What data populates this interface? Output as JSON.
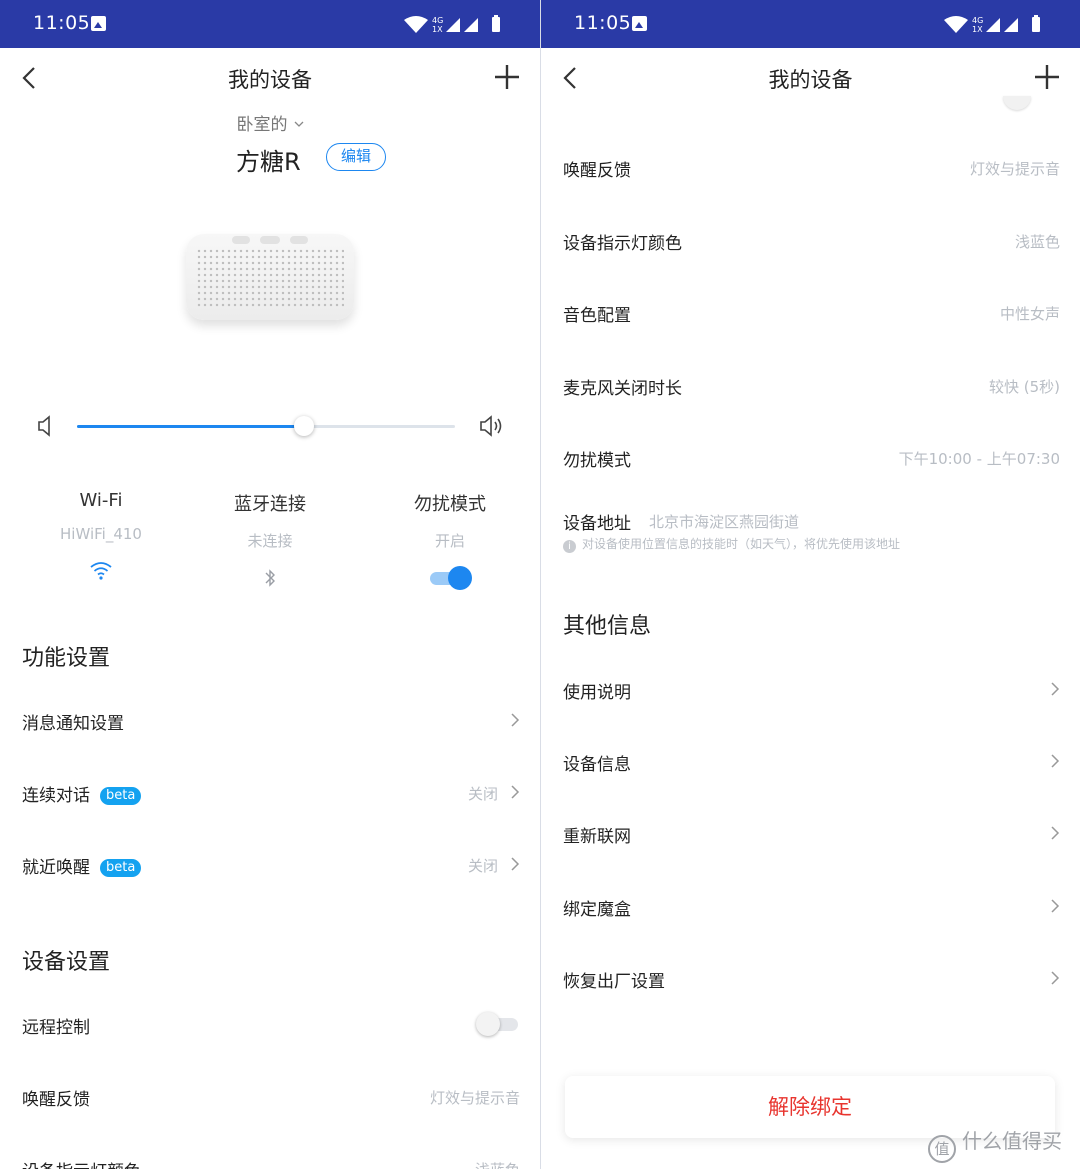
{
  "status": {
    "time": "11:05",
    "network": "4G 1X"
  },
  "header": {
    "title": "我的设备"
  },
  "left": {
    "room": "卧室的",
    "device_name": "方糖R",
    "edit_label": "编辑",
    "volume": 0.6,
    "stats": [
      {
        "title": "Wi-Fi",
        "sub": "HiWiFi_410"
      },
      {
        "title": "蓝牙连接",
        "sub": "未连接"
      },
      {
        "title": "勿扰模式",
        "sub": "开启",
        "toggle_on": true
      }
    ],
    "func_section": "功能设置",
    "func_items": [
      {
        "label": "消息通知设置",
        "value": ""
      },
      {
        "label": "连续对话",
        "badge": "beta",
        "value": "关闭"
      },
      {
        "label": "就近唤醒",
        "badge": "beta",
        "value": "关闭"
      }
    ],
    "device_section": "设备设置",
    "device_items": [
      {
        "label": "远程控制",
        "toggle_on": false
      },
      {
        "label": "唤醒反馈",
        "value": "灯效与提示音"
      },
      {
        "label": "设备指示灯颜色",
        "value": "浅蓝色"
      }
    ]
  },
  "right": {
    "rows": [
      {
        "label": "唤醒反馈",
        "value": "灯效与提示音"
      },
      {
        "label": "设备指示灯颜色",
        "value": "浅蓝色"
      },
      {
        "label": "音色配置",
        "value": "中性女声"
      },
      {
        "label": "麦克风关闭时长",
        "value": "较快 (5秒)"
      },
      {
        "label": "勿扰模式",
        "value": "下午10:00 - 上午07:30"
      }
    ],
    "address": {
      "label": "设备地址",
      "value": "北京市海淀区燕园街道",
      "note": "对设备使用位置信息的技能时（如天气），将优先使用该地址",
      "info_icon_glyph": "i"
    },
    "other_section": "其他信息",
    "other_items": [
      {
        "label": "使用说明"
      },
      {
        "label": "设备信息"
      },
      {
        "label": "重新联网"
      },
      {
        "label": "绑定魔盒"
      },
      {
        "label": "恢复出厂设置"
      }
    ],
    "unbind_label": "解除绑定",
    "watermark": "什么值得买",
    "watermark_logo": "值"
  },
  "colors": {
    "status_bar": "#2a3aa6",
    "accent": "#1d87f0",
    "danger": "#e8352f",
    "beta": "#14a2f0"
  }
}
